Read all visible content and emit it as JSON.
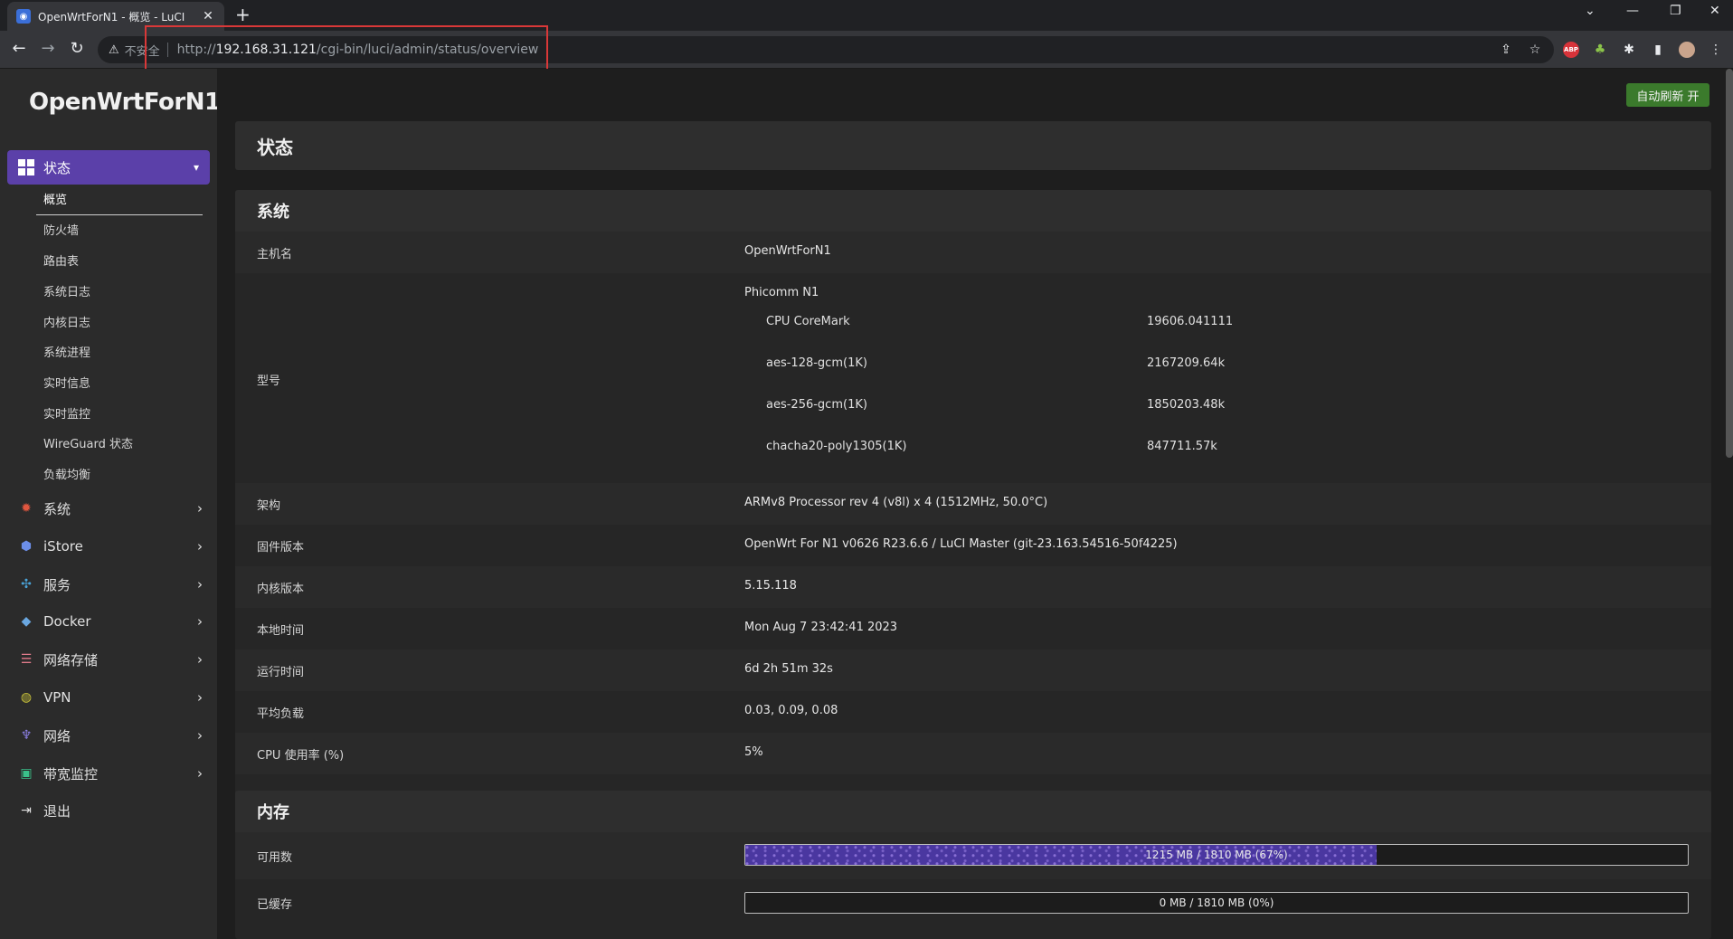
{
  "browser": {
    "tab_title": "OpenWrtForN1 - 概览 - LuCI",
    "new_tab": "+",
    "insecure_label": "不安全",
    "url_prefix": "http://",
    "url_host": "192.168.31.121",
    "url_path": "/cgi-bin/luci/admin/status/overview",
    "ext_abp": "ABP"
  },
  "sidebar": {
    "logo": "OpenWrtForN1",
    "active_menu": "状态",
    "submenu": [
      "概览",
      "防火墙",
      "路由表",
      "系统日志",
      "内核日志",
      "系统进程",
      "实时信息",
      "实时监控",
      "WireGuard 状态",
      "负载均衡"
    ],
    "menu": [
      {
        "label": "系统",
        "icon": "gear-icon"
      },
      {
        "label": "iStore",
        "icon": "cube-icon"
      },
      {
        "label": "服务",
        "icon": "puzzle-icon"
      },
      {
        "label": "Docker",
        "icon": "docker-icon"
      },
      {
        "label": "网络存储",
        "icon": "database-icon"
      },
      {
        "label": "VPN",
        "icon": "globe-icon"
      },
      {
        "label": "网络",
        "icon": "network-icon"
      },
      {
        "label": "带宽监控",
        "icon": "monitor-icon"
      },
      {
        "label": "退出",
        "icon": "logout-icon"
      }
    ]
  },
  "main": {
    "refresh_button": "自动刷新 开",
    "page_title": "状态",
    "system": {
      "title": "系统",
      "rows": [
        {
          "label": "主机名",
          "value": "OpenWrtForN1"
        },
        {
          "label": "型号",
          "value": "Phicomm N1"
        },
        {
          "label": "架构",
          "value": "ARMv8 Processor rev 4 (v8l) x 4 (1512MHz, 50.0°C)"
        },
        {
          "label": "固件版本",
          "value": "OpenWrt For N1 v0626 R23.6.6 / LuCI Master (git-23.163.54516-50f4225)"
        },
        {
          "label": "内核版本",
          "value": "5.15.118"
        },
        {
          "label": "本地时间",
          "value": "Mon Aug 7 23:42:41 2023"
        },
        {
          "label": "运行时间",
          "value": "6d 2h 51m 32s"
        },
        {
          "label": "平均负载",
          "value": "0.03, 0.09, 0.08"
        },
        {
          "label": "CPU 使用率 (%)",
          "value": "5%"
        }
      ],
      "benchmarks": [
        {
          "label": "CPU CoreMark",
          "value": "19606.041111"
        },
        {
          "label": "aes-128-gcm(1K)",
          "value": "2167209.64k"
        },
        {
          "label": "aes-256-gcm(1K)",
          "value": "1850203.48k"
        },
        {
          "label": "chacha20-poly1305(1K)",
          "value": "847711.57k"
        }
      ]
    },
    "memory": {
      "title": "内存",
      "rows": [
        {
          "label": "可用数",
          "text": "1215 MB / 1810 MB (67%)",
          "fraction": 0.67
        },
        {
          "label": "已缓存",
          "text": "0 MB / 1810 MB (0%)",
          "fraction": 0.0
        }
      ]
    }
  }
}
